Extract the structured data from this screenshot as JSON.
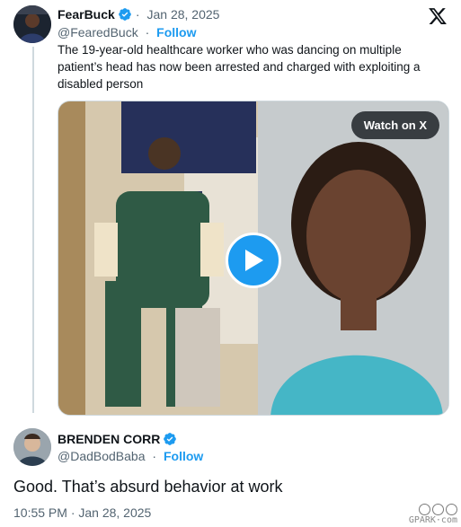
{
  "quoted_tweet": {
    "display_name": "FearBuck",
    "date": "Jan 28, 2025",
    "date_separator": "·",
    "handle": "@FearedBuck",
    "follow_label": "Follow",
    "handle_separator": "·",
    "text": "The 19-year-old healthcare worker who was dancing on multiple patient’s head has now been arrested and charged with exploiting a disabled person",
    "media": {
      "watch_label": "Watch on X"
    }
  },
  "reply": {
    "display_name": "BRENDEN CORR",
    "handle": "@DadBodBaba",
    "handle_separator": "·",
    "follow_label": "Follow",
    "text": "Good. That’s absurd behavior at work",
    "timestamp": "10:55 PM · Jan 28, 2025"
  },
  "watermark": {
    "text": "GPARK·com"
  },
  "colors": {
    "accent": "#1d9bf0",
    "secondary_text": "#536471",
    "primary_text": "#0f1419",
    "border": "#cfd9de"
  },
  "icons": {
    "verified": "verified-badge-icon",
    "x_logo": "x-logo-icon",
    "play": "play-icon"
  }
}
